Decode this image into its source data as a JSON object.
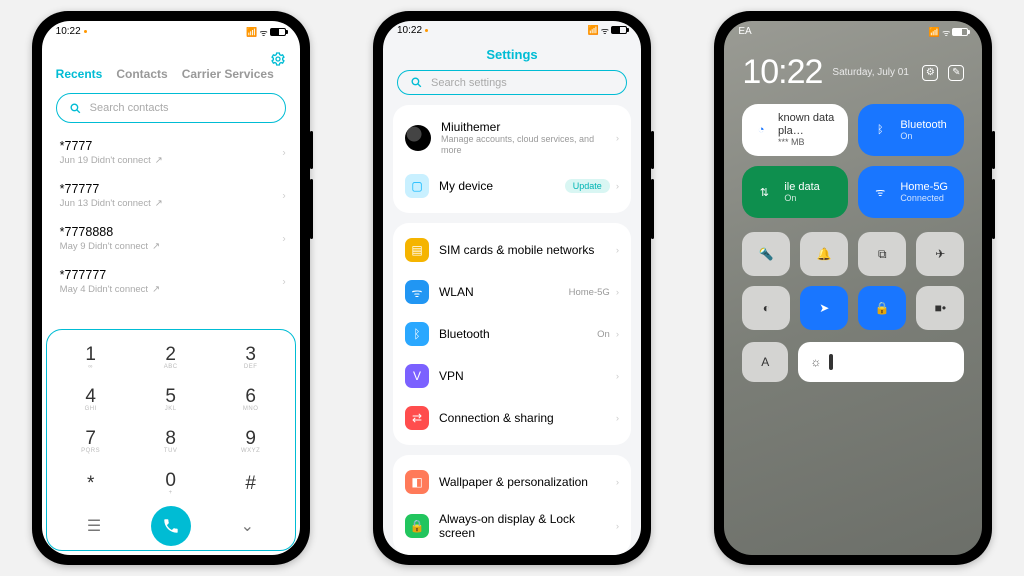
{
  "status": {
    "time": "10:22",
    "ea": "EA"
  },
  "dialer": {
    "tabs": {
      "recents": "Recents",
      "contacts": "Contacts",
      "carrier": "Carrier Services"
    },
    "search_placeholder": "Search contacts",
    "calls": [
      {
        "number": "*7777",
        "meta": "Jun 19 Didn't connect"
      },
      {
        "number": "*77777",
        "meta": "Jun 13 Didn't connect"
      },
      {
        "number": "*7778888",
        "meta": "May 9 Didn't connect"
      },
      {
        "number": "*777777",
        "meta": "May 4 Didn't connect"
      }
    ],
    "keys": [
      [
        "1",
        "∞"
      ],
      [
        "2",
        "ABC"
      ],
      [
        "3",
        "DEF"
      ],
      [
        "4",
        "GHI"
      ],
      [
        "5",
        "JKL"
      ],
      [
        "6",
        "MNO"
      ],
      [
        "7",
        "PQRS"
      ],
      [
        "8",
        "TUV"
      ],
      [
        "9",
        "WXYZ"
      ],
      [
        "*",
        ""
      ],
      [
        "0",
        "+"
      ],
      [
        "#",
        ""
      ]
    ]
  },
  "settings": {
    "title": "Settings",
    "search_placeholder": "Search settings",
    "account": {
      "name": "Miuithemer",
      "sub": "Manage accounts, cloud services, and more"
    },
    "mydevice": {
      "label": "My device",
      "chip": "Update"
    },
    "rows1": [
      {
        "icon": "#f5b400",
        "glyph": "▤",
        "label": "SIM cards & mobile networks",
        "right": ""
      },
      {
        "icon": "#2196f3",
        "glyph": "ᯤ",
        "label": "WLAN",
        "right": "Home-5G"
      },
      {
        "icon": "#2aa8ff",
        "glyph": "ᛒ",
        "label": "Bluetooth",
        "right": "On"
      },
      {
        "icon": "#7b61ff",
        "glyph": "V",
        "label": "VPN",
        "right": ""
      },
      {
        "icon": "#ff4d4d",
        "glyph": "⇄",
        "label": "Connection & sharing",
        "right": ""
      }
    ],
    "rows2": [
      {
        "icon": "#ff7a59",
        "glyph": "◧",
        "label": "Wallpaper & personalization"
      },
      {
        "icon": "#22c55e",
        "glyph": "🔒",
        "label": "Always-on display & Lock screen"
      }
    ]
  },
  "cc": {
    "time": "10:22",
    "date": "Saturday, July 01",
    "tiles": [
      {
        "style": "white",
        "title": "known data pla…",
        "sub": "*** MB"
      },
      {
        "style": "blue",
        "title": "Bluetooth",
        "sub": "On"
      },
      {
        "style": "green",
        "title": "ile data",
        "sub": "On"
      },
      {
        "style": "blue",
        "title": "Home-5G",
        "sub": "Connected"
      }
    ]
  }
}
